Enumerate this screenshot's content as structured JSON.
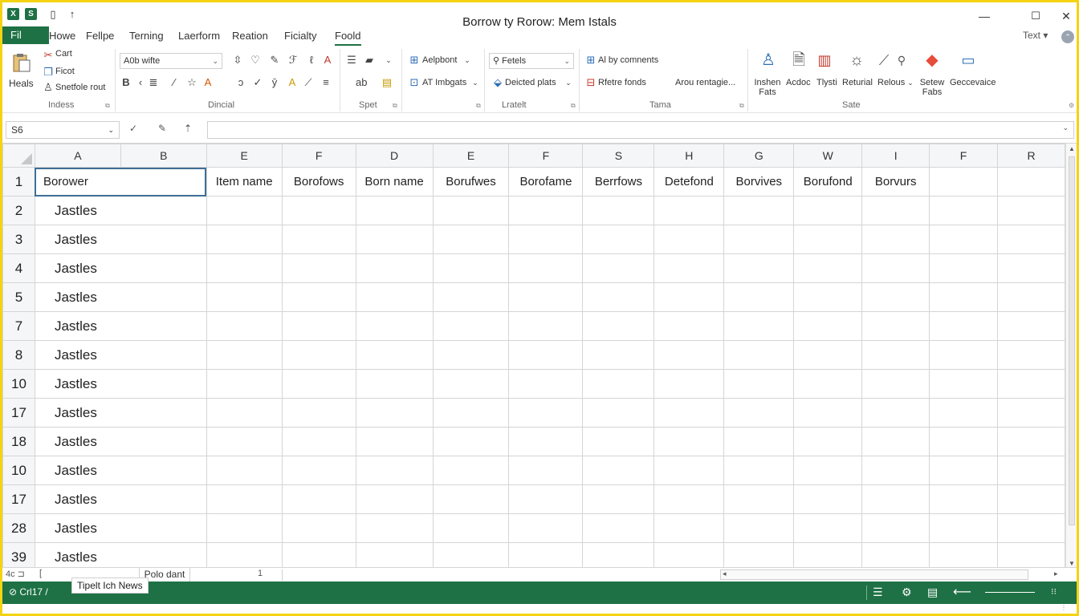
{
  "window": {
    "title": "Borrow ty Rorow: Mem Istals",
    "minimize": "—",
    "maximize": "☐",
    "close": "✕"
  },
  "quick_access": {
    "app_icon": "X",
    "save_icon": "S",
    "doc_icon": "▯",
    "touch_icon": "↑"
  },
  "tabs": {
    "file": "Fil",
    "items": [
      "Howe",
      "Fellpe",
      "Terning",
      "Laerform",
      "Reation",
      "Ficialty",
      "Foold"
    ]
  },
  "text_menu": "Text ▾",
  "ribbon": {
    "clipboard": {
      "paste": "Heals",
      "cut": "Cart",
      "copy": "Ficot",
      "format": "Snetfole rout",
      "label": "Indess"
    },
    "font": {
      "font_name": "A0b wifte",
      "label": "Dincial"
    },
    "alignment": {
      "label": "Spet"
    },
    "styles": {
      "alphabet": "Aelpbont",
      "images": "AT Imbgats",
      "label": ""
    },
    "cells": {
      "fetch": "Fetels",
      "deleted": "Deicted plats",
      "label": "Lratelt"
    },
    "editing": {
      "comments": "Al by comnents",
      "refine": "Rfetre fonds",
      "area": "Arou rentagie...",
      "label": "Tama"
    },
    "insert": {
      "insert": "Inshen Fats",
      "action": "Acdoc",
      "trysti": "Tlysti",
      "returnal": "Returial",
      "relous": "Relous",
      "setew": "Setew Fabs",
      "geco": "Geccevaice",
      "label": "Sate"
    }
  },
  "formula_bar": {
    "name_box": "S6",
    "cancel": "✓"
  },
  "grid": {
    "columns": [
      "A",
      "B",
      "E",
      "F",
      "D",
      "E",
      "F",
      "S",
      "H",
      "G",
      "W",
      "I",
      "F",
      "R"
    ],
    "header_row": [
      "Borower",
      "Item name",
      "Borofows",
      "Born name",
      "Borufwes",
      "Borofame",
      "Berrfows",
      "Detefond",
      "Borvives",
      "Borufond",
      "Borvurs",
      "",
      ""
    ],
    "row_numbers": [
      "1",
      "2",
      "3",
      "4",
      "5",
      "7",
      "8",
      "10",
      "17",
      "18",
      "10",
      "17",
      "28",
      "39"
    ],
    "values": [
      "Jastles",
      "Jastles",
      "Jastles",
      "Jastles",
      "Jastles",
      "Jastles",
      "Jastles",
      "Jastles",
      "Jastles",
      "Jastles",
      "Jastles",
      "Jastles",
      "Jastles"
    ]
  },
  "sheets": {
    "nav": "4c ⊐",
    "nav2": "[",
    "active": "Polo dant",
    "count": "1"
  },
  "status": {
    "ready": "⊘ Crl17 /",
    "tooltip": "Tipelt Ich News"
  },
  "colors": {
    "accent": "#1e7145",
    "frame": "#f4d312",
    "selection": "#3e6f96"
  }
}
